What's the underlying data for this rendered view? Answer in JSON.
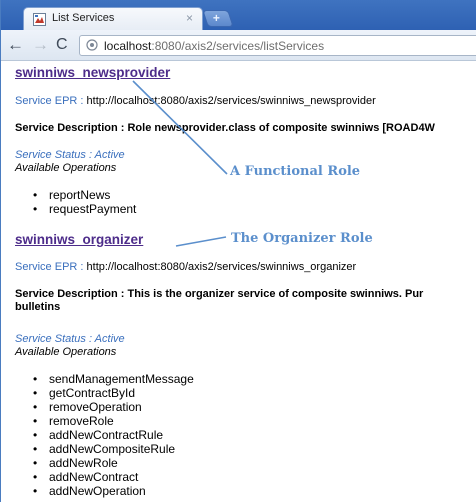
{
  "browser": {
    "tab_title": "List Services",
    "tab_close": "×",
    "new_tab": "+",
    "url_host": "localhost",
    "url_rest": ":8080/axis2/services/listServices",
    "back_icon": "back-arrow-icon",
    "forward_icon": "forward-arrow-icon",
    "reload_icon": "reload-icon"
  },
  "services": [
    {
      "name": "swinniws_newsprovider",
      "epr_label": "Service EPR :",
      "epr_value": "http://localhost:8080/axis2/services/swinniws_newsprovider",
      "description": "Service Description : Role newsprovider.class of composite swinniws [ROAD4W",
      "status": "Service Status : Active",
      "ops_title": "Available Operations",
      "operations": [
        "reportNews",
        "requestPayment"
      ]
    },
    {
      "name": "swinniws_organizer",
      "epr_label": "Service EPR :",
      "epr_value": "http://localhost:8080/axis2/services/swinniws_organizer",
      "description_line1": "Service Description : This is the organizer service of composite swinniws. Pur",
      "description_line2": "bulletins",
      "status": "Service Status : Active",
      "ops_title": "Available Operations",
      "operations": [
        "sendManagementMessage",
        "getContractById",
        "removeOperation",
        "removeRole",
        "addNewContractRule",
        "addNewCompositeRule",
        "addNewRole",
        "addNewContract",
        "addNewOperation"
      ]
    }
  ],
  "annotations": {
    "functional": "A Functional Role",
    "organizer": "The Organizer Role",
    "color": "#5b8fcc"
  }
}
